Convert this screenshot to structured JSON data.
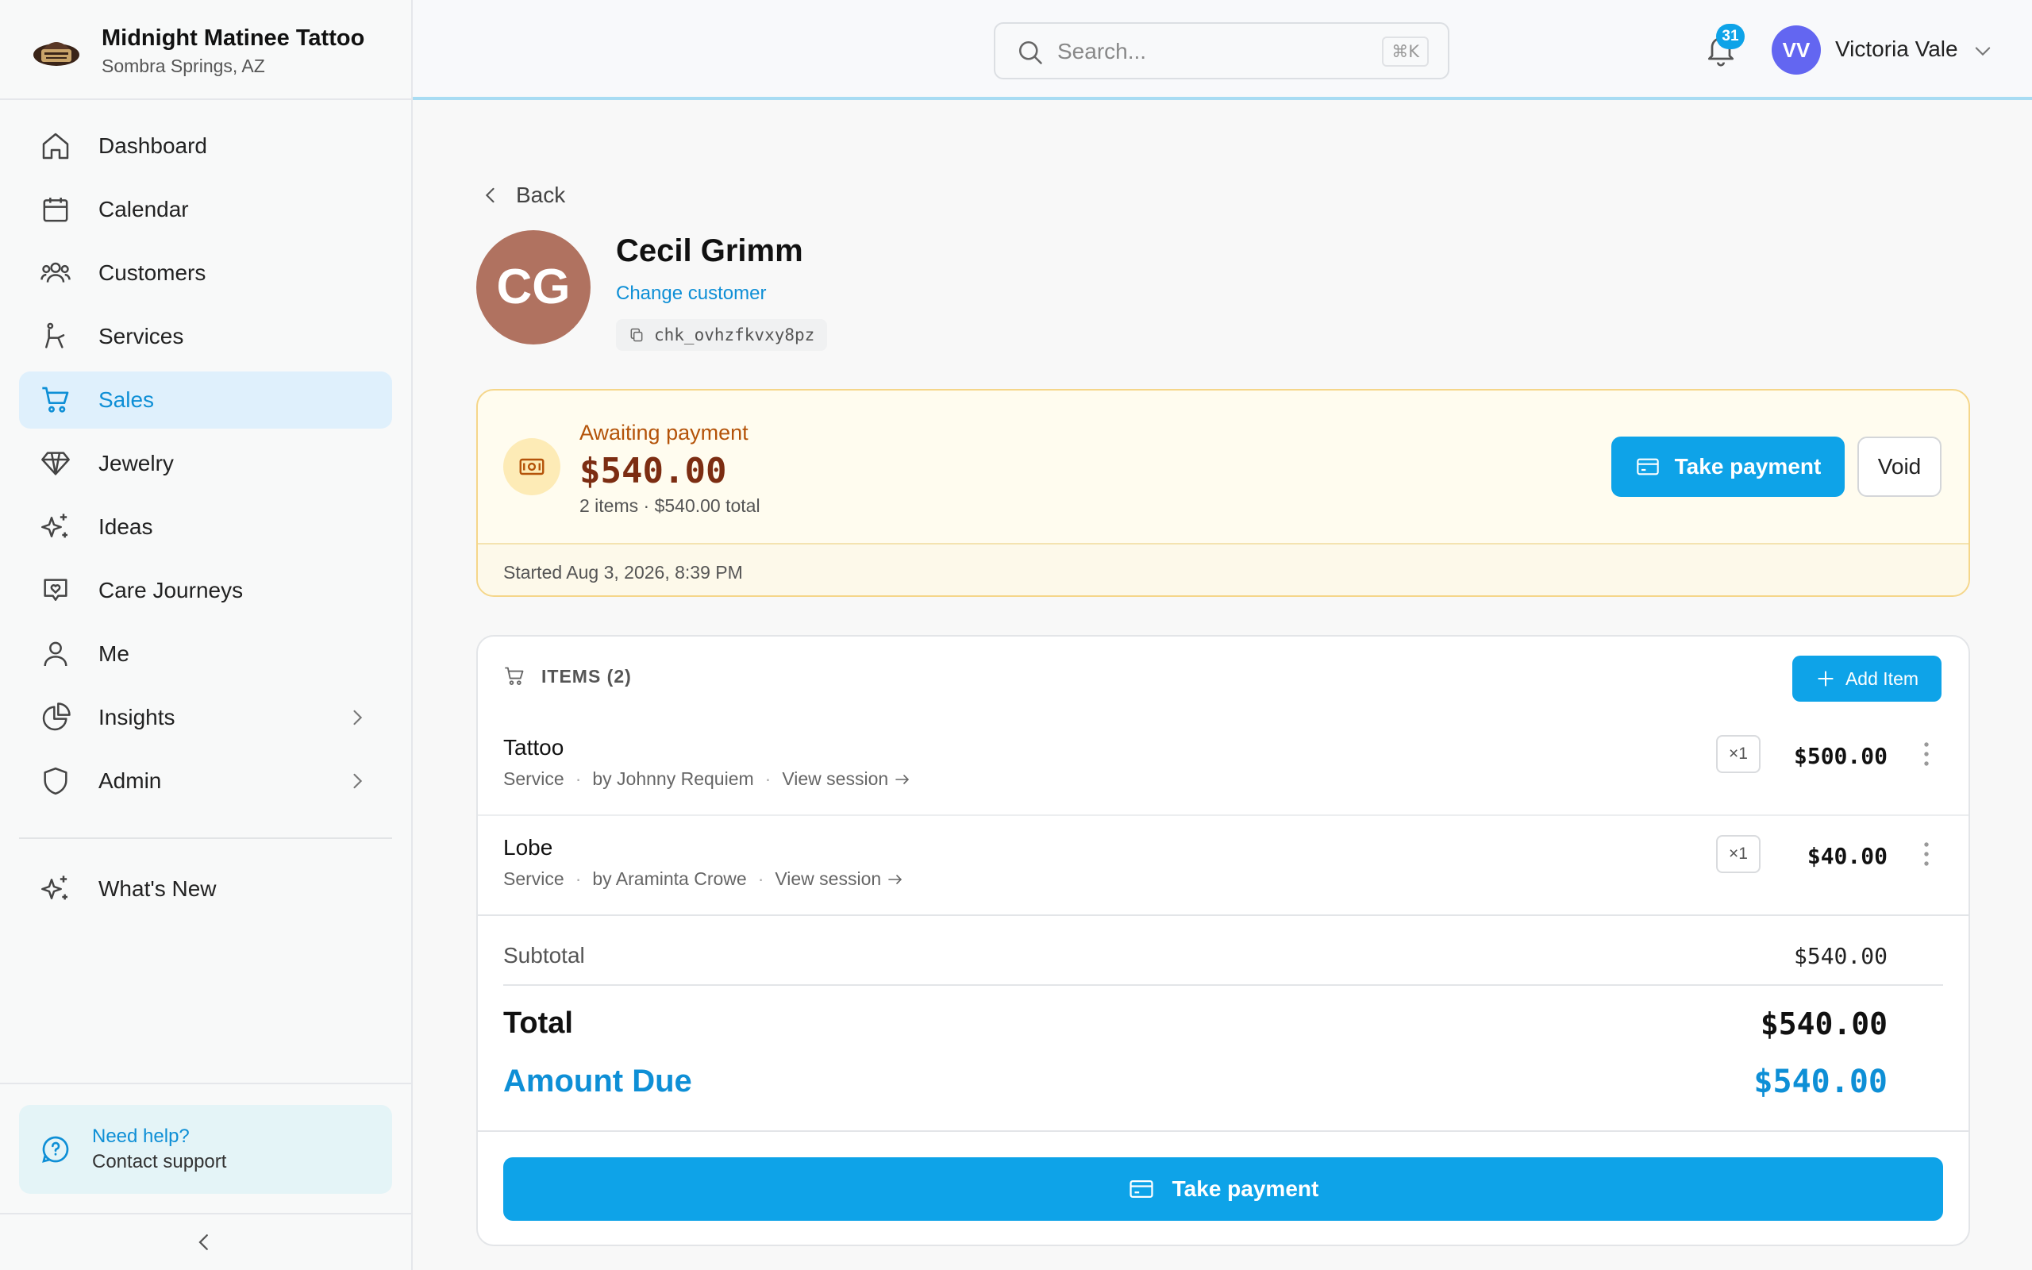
{
  "brand": {
    "name": "Midnight Matinee Tattoo",
    "location": "Sombra Springs, AZ",
    "logo_icon": "shop-logo"
  },
  "sidebar": {
    "items": [
      {
        "label": "Dashboard",
        "icon": "home-icon"
      },
      {
        "label": "Calendar",
        "icon": "calendar-icon"
      },
      {
        "label": "Customers",
        "icon": "users-icon"
      },
      {
        "label": "Services",
        "icon": "chair-icon"
      },
      {
        "label": "Sales",
        "icon": "cart-icon",
        "active": true
      },
      {
        "label": "Jewelry",
        "icon": "gem-icon"
      },
      {
        "label": "Ideas",
        "icon": "sparkles-icon"
      },
      {
        "label": "Care Journeys",
        "icon": "heart-chat-icon"
      },
      {
        "label": "Me",
        "icon": "user-icon"
      },
      {
        "label": "Insights",
        "icon": "pie-chart-icon",
        "expandable": true
      },
      {
        "label": "Admin",
        "icon": "shield-icon",
        "expandable": true
      }
    ],
    "whats_new": "What's New",
    "help": {
      "title": "Need help?",
      "subtitle": "Contact support"
    }
  },
  "topbar": {
    "search_placeholder": "Search...",
    "search_shortcut": "⌘K",
    "notifications_count": "31",
    "user_initials": "VV",
    "user_name": "Victoria Vale"
  },
  "checkout": {
    "back_label": "Back",
    "customer": {
      "initials": "CG",
      "name": "Cecil Grimm",
      "change_label": "Change customer",
      "checkout_id": "chk_ovhzfkvxy8pz"
    },
    "status": {
      "label": "Awaiting payment",
      "amount": "$540.00",
      "summary": "2 items · $540.00 total",
      "started": "Started Aug 3, 2026, 8:39 PM",
      "take_payment_label": "Take payment",
      "void_label": "Void"
    },
    "items_header": "ITEMS (2)",
    "add_item_label": "Add Item",
    "items": [
      {
        "name": "Tattoo",
        "type": "Service",
        "by": "by Johnny Requiem",
        "view_label": "View session",
        "qty": "×1",
        "price": "$500.00"
      },
      {
        "name": "Lobe",
        "type": "Service",
        "by": "by Araminta Crowe",
        "view_label": "View session",
        "qty": "×1",
        "price": "$40.00"
      }
    ],
    "subtotal_label": "Subtotal",
    "subtotal": "$540.00",
    "total_label": "Total",
    "total": "$540.00",
    "amount_due_label": "Amount Due",
    "amount_due": "$540.00",
    "footer_button_label": "Take payment"
  },
  "colors": {
    "accent": "#0ea3e8",
    "active_nav_bg": "#dff0fc",
    "awaiting_text": "#b45309",
    "awaiting_bg": "#fffcef",
    "customer_avatar": "#b07260",
    "user_avatar": "#6366f1"
  }
}
